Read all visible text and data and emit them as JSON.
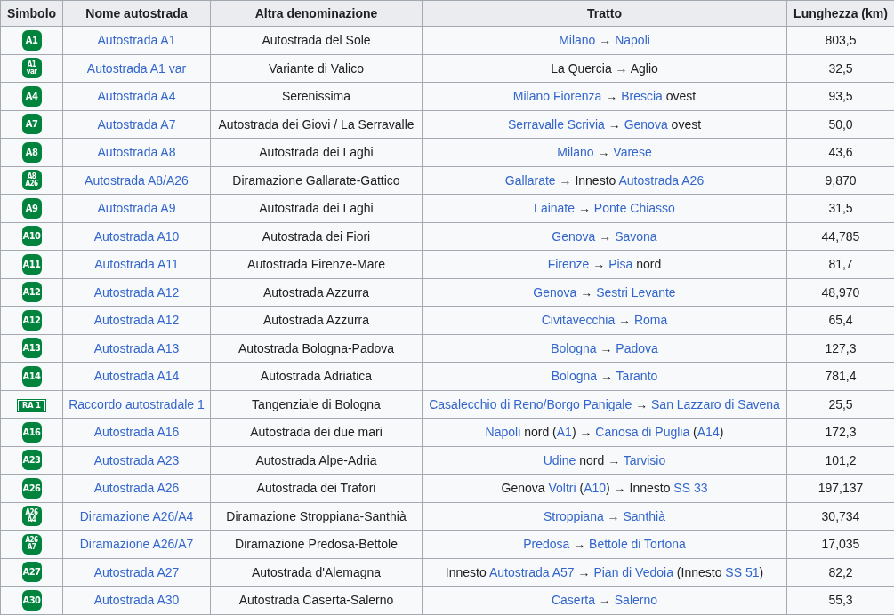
{
  "table": {
    "columns": [
      "Simbolo",
      "Nome autostrada",
      "Altra denominazione",
      "Tratto",
      "Lunghezza (km)"
    ],
    "rows": [
      {
        "symbol": {
          "kind": "shield",
          "lines": [
            "A1"
          ]
        },
        "name": "Autostrada A1",
        "other": "Autostrada del Sole",
        "route": [
          {
            "text": "Milano",
            "link": true
          },
          {
            "text": " → ",
            "link": false
          },
          {
            "text": "Napoli",
            "link": true
          }
        ],
        "length": "803,5"
      },
      {
        "symbol": {
          "kind": "shield",
          "lines": [
            "A1",
            "var"
          ]
        },
        "name": "Autostrada A1 var",
        "other": "Variante di Valico",
        "route": [
          {
            "text": "La Quercia → Aglio",
            "link": false
          }
        ],
        "length": "32,5"
      },
      {
        "symbol": {
          "kind": "shield",
          "lines": [
            "A4"
          ]
        },
        "name": "Autostrada A4",
        "other": "Serenissima",
        "route": [
          {
            "text": "Milano Fiorenza",
            "link": true
          },
          {
            "text": " → ",
            "link": false
          },
          {
            "text": "Brescia",
            "link": true
          },
          {
            "text": " ovest",
            "link": false
          }
        ],
        "length": "93,5"
      },
      {
        "symbol": {
          "kind": "shield",
          "lines": [
            "A7"
          ]
        },
        "name": "Autostrada A7",
        "other": "Autostrada dei Giovi / La Serravalle",
        "route": [
          {
            "text": "Serravalle Scrivia",
            "link": true
          },
          {
            "text": " → ",
            "link": false
          },
          {
            "text": "Genova",
            "link": true
          },
          {
            "text": " ovest",
            "link": false
          }
        ],
        "length": "50,0"
      },
      {
        "symbol": {
          "kind": "shield",
          "lines": [
            "A8"
          ]
        },
        "name": "Autostrada A8",
        "other": "Autostrada dei Laghi",
        "route": [
          {
            "text": "Milano",
            "link": true
          },
          {
            "text": " → ",
            "link": false
          },
          {
            "text": "Varese",
            "link": true
          }
        ],
        "length": "43,6"
      },
      {
        "symbol": {
          "kind": "shield",
          "lines": [
            "A8",
            "A26"
          ]
        },
        "name": "Autostrada A8/A26",
        "other": "Diramazione Gallarate-Gattico",
        "route": [
          {
            "text": "Gallarate",
            "link": true
          },
          {
            "text": " → Innesto ",
            "link": false
          },
          {
            "text": "Autostrada A26",
            "link": true
          }
        ],
        "length": "9,870"
      },
      {
        "symbol": {
          "kind": "shield",
          "lines": [
            "A9"
          ]
        },
        "name": "Autostrada A9",
        "other": "Autostrada dei Laghi",
        "route": [
          {
            "text": "Lainate",
            "link": true
          },
          {
            "text": " → ",
            "link": false
          },
          {
            "text": "Ponte Chiasso",
            "link": true
          }
        ],
        "length": "31,5"
      },
      {
        "symbol": {
          "kind": "shield",
          "lines": [
            "A10"
          ]
        },
        "name": "Autostrada A10",
        "other": "Autostrada dei Fiori",
        "route": [
          {
            "text": "Genova",
            "link": true
          },
          {
            "text": " → ",
            "link": false
          },
          {
            "text": "Savona",
            "link": true
          }
        ],
        "length": "44,785"
      },
      {
        "symbol": {
          "kind": "shield",
          "lines": [
            "A11"
          ]
        },
        "name": "Autostrada A11",
        "other": "Autostrada Firenze-Mare",
        "route": [
          {
            "text": "Firenze",
            "link": true
          },
          {
            "text": " → ",
            "link": false
          },
          {
            "text": "Pisa",
            "link": true
          },
          {
            "text": " nord",
            "link": false
          }
        ],
        "length": "81,7"
      },
      {
        "symbol": {
          "kind": "shield",
          "lines": [
            "A12"
          ]
        },
        "name": "Autostrada A12",
        "other": "Autostrada Azzurra",
        "route": [
          {
            "text": "Genova",
            "link": true
          },
          {
            "text": " → ",
            "link": false
          },
          {
            "text": "Sestri Levante",
            "link": true
          }
        ],
        "length": "48,970"
      },
      {
        "symbol": {
          "kind": "shield",
          "lines": [
            "A12"
          ]
        },
        "name": "Autostrada A12",
        "other": "Autostrada Azzurra",
        "route": [
          {
            "text": "Civitavecchia",
            "link": true
          },
          {
            "text": " → ",
            "link": false
          },
          {
            "text": "Roma",
            "link": true
          }
        ],
        "length": "65,4"
      },
      {
        "symbol": {
          "kind": "shield",
          "lines": [
            "A13"
          ]
        },
        "name": "Autostrada A13",
        "other": "Autostrada Bologna-Padova",
        "route": [
          {
            "text": "Bologna",
            "link": true
          },
          {
            "text": " → ",
            "link": false
          },
          {
            "text": "Padova",
            "link": true
          }
        ],
        "length": "127,3"
      },
      {
        "symbol": {
          "kind": "shield",
          "lines": [
            "A14"
          ]
        },
        "name": "Autostrada A14",
        "other": "Autostrada Adriatica",
        "route": [
          {
            "text": "Bologna",
            "link": true
          },
          {
            "text": " → ",
            "link": false
          },
          {
            "text": "Taranto",
            "link": true
          }
        ],
        "length": "781,4"
      },
      {
        "symbol": {
          "kind": "plate",
          "lines": [
            "RA 1"
          ]
        },
        "name": "Raccordo autostradale 1",
        "other": "Tangenziale di Bologna",
        "route": [
          {
            "text": "Casalecchio di Reno/Borgo Panigale",
            "link": true
          },
          {
            "text": " → ",
            "link": false
          },
          {
            "text": "San Lazzaro di Savena",
            "link": true
          }
        ],
        "length": "25,5"
      },
      {
        "symbol": {
          "kind": "shield",
          "lines": [
            "A16"
          ]
        },
        "name": "Autostrada A16",
        "other": "Autostrada dei due mari",
        "route": [
          {
            "text": "Napoli",
            "link": true
          },
          {
            "text": " nord (",
            "link": false
          },
          {
            "text": "A1",
            "link": true
          },
          {
            "text": ") → ",
            "link": false
          },
          {
            "text": "Canosa di Puglia",
            "link": true
          },
          {
            "text": " (",
            "link": false
          },
          {
            "text": "A14",
            "link": true
          },
          {
            "text": ")",
            "link": false
          }
        ],
        "length": "172,3"
      },
      {
        "symbol": {
          "kind": "shield",
          "lines": [
            "A23"
          ]
        },
        "name": "Autostrada A23",
        "other": "Autostrada Alpe-Adria",
        "route": [
          {
            "text": "Udine",
            "link": true
          },
          {
            "text": " nord → ",
            "link": false
          },
          {
            "text": "Tarvisio",
            "link": true
          }
        ],
        "length": "101,2"
      },
      {
        "symbol": {
          "kind": "shield",
          "lines": [
            "A26"
          ]
        },
        "name": "Autostrada A26",
        "other": "Autostrada dei Trafori",
        "route": [
          {
            "text": "Genova ",
            "link": false
          },
          {
            "text": "Voltri",
            "link": true
          },
          {
            "text": " (",
            "link": false
          },
          {
            "text": "A10",
            "link": true
          },
          {
            "text": ") → Innesto ",
            "link": false
          },
          {
            "text": "SS 33",
            "link": true
          }
        ],
        "length": "197,137"
      },
      {
        "symbol": {
          "kind": "shield",
          "lines": [
            "A26",
            "A4"
          ]
        },
        "name": "Diramazione A26/A4",
        "other": "Diramazione Stroppiana-Santhià",
        "route": [
          {
            "text": "Stroppiana",
            "link": true
          },
          {
            "text": " → ",
            "link": false
          },
          {
            "text": "Santhià",
            "link": true
          }
        ],
        "length": "30,734"
      },
      {
        "symbol": {
          "kind": "shield",
          "lines": [
            "A26",
            "A7"
          ]
        },
        "name": "Diramazione A26/A7",
        "other": "Diramazione Predosa-Bettole",
        "route": [
          {
            "text": "Predosa",
            "link": true
          },
          {
            "text": " → ",
            "link": false
          },
          {
            "text": "Bettole di Tortona",
            "link": true
          }
        ],
        "length": "17,035"
      },
      {
        "symbol": {
          "kind": "shield",
          "lines": [
            "A27"
          ]
        },
        "name": "Autostrada A27",
        "other": "Autostrada d'Alemagna",
        "route": [
          {
            "text": "Innesto ",
            "link": false
          },
          {
            "text": "Autostrada A57",
            "link": true
          },
          {
            "text": " → ",
            "link": false
          },
          {
            "text": "Pian di Vedoia",
            "link": true
          },
          {
            "text": " (Innesto ",
            "link": false
          },
          {
            "text": "SS 51",
            "link": true
          },
          {
            "text": ")",
            "link": false
          }
        ],
        "length": "82,2"
      },
      {
        "symbol": {
          "kind": "shield",
          "lines": [
            "A30"
          ]
        },
        "name": "Autostrada A30",
        "other": "Autostrada Caserta-Salerno",
        "route": [
          {
            "text": "Caserta",
            "link": true
          },
          {
            "text": " → ",
            "link": false
          },
          {
            "text": "Salerno",
            "link": true
          }
        ],
        "length": "55,3"
      }
    ]
  }
}
